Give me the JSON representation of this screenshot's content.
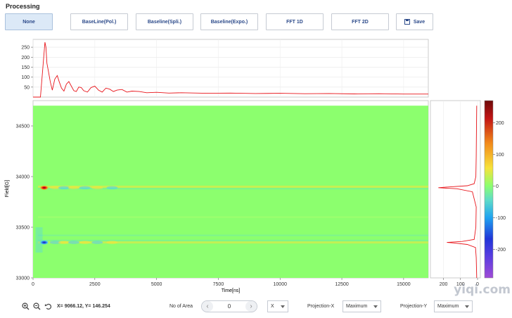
{
  "panel": {
    "title": "Processing"
  },
  "toolbar": {
    "buttons": [
      {
        "label": "None",
        "active": true
      },
      {
        "label": "BaseLine(Pol.)"
      },
      {
        "label": "Baseline(Spli.)"
      },
      {
        "label": "Baseline(Expo.)"
      },
      {
        "label": "FFT 1D"
      },
      {
        "label": "FFT 2D"
      },
      {
        "label": "Save",
        "icon": "save-icon"
      }
    ]
  },
  "chart_data": [
    {
      "type": "line",
      "name": "projection-x",
      "x": [
        0,
        300,
        400,
        480,
        520,
        560,
        620,
        700,
        780,
        880,
        980,
        1050,
        1150,
        1250,
        1350,
        1450,
        1550,
        1650,
        1750,
        1850,
        1950,
        2050,
        2200,
        2350,
        2500,
        2650,
        2800,
        2950,
        3100,
        3250,
        3400,
        3600,
        3800,
        4000,
        4300,
        4600,
        5000,
        5500,
        6000,
        7000,
        8000,
        9000,
        10000,
        11000,
        12000,
        13000,
        14000,
        15000,
        16000
      ],
      "y": [
        0,
        0,
        150,
        275,
        250,
        170,
        130,
        75,
        35,
        90,
        108,
        80,
        45,
        30,
        65,
        78,
        55,
        32,
        28,
        50,
        48,
        32,
        25,
        48,
        55,
        35,
        25,
        45,
        40,
        28,
        35,
        38,
        25,
        30,
        28,
        22,
        24,
        20,
        22,
        19,
        20,
        18,
        19,
        17,
        18,
        16,
        17,
        15,
        15
      ],
      "xlim": [
        0,
        16000
      ],
      "ylim": [
        0,
        275
      ],
      "yticks": [
        "250",
        "200",
        "150",
        "100",
        "50"
      ],
      "color": "#e8141a"
    },
    {
      "type": "heatmap",
      "name": "field-vs-time",
      "xlabel": "Time[ns]",
      "ylabel": "Field[G]",
      "xlim": [
        0,
        16000
      ],
      "ylim": [
        33000,
        34750
      ],
      "xticks": [
        "0",
        "2500",
        "5000",
        "7500",
        "10000",
        "12500",
        "15000"
      ],
      "yticks": [
        "34500",
        "34000",
        "33500",
        "33000"
      ],
      "data_extent": {
        "y": [
          33000,
          34700
        ]
      },
      "background_value": 0,
      "features": [
        {
          "field": 33890,
          "time": 450,
          "value": 260
        },
        {
          "field": 33350,
          "time": 450,
          "value": -190
        }
      ]
    },
    {
      "type": "line",
      "name": "projection-y",
      "xticks": [
        "200",
        "100",
        "0"
      ],
      "field": [
        33000,
        33200,
        33300,
        33330,
        33345,
        33350,
        33360,
        33380,
        33500,
        33700,
        33850,
        33880,
        33890,
        33900,
        33910,
        33930,
        34000,
        34200,
        34500,
        34700
      ],
      "value": [
        5,
        8,
        12,
        60,
        140,
        180,
        90,
        20,
        10,
        8,
        30,
        120,
        230,
        150,
        60,
        20,
        10,
        8,
        6,
        5
      ],
      "color": "#e8141a"
    },
    {
      "type": "colorbar",
      "ticks": [
        "200",
        "100",
        "0",
        "-100",
        "-200"
      ],
      "range": [
        -290,
        270
      ],
      "colors": [
        "#a04bd6",
        "#2035d8",
        "#1fa3f0",
        "#5fdcc8",
        "#8cff6e",
        "#f7e23a",
        "#f28a1a",
        "#c21414",
        "#6e0a0a"
      ]
    }
  ],
  "status": {
    "coords_text": "X= 9066.12,  Y= 146.254",
    "zoom_in_icon": "zoom-in-icon",
    "zoom_out_icon": "zoom-out-icon",
    "reset_icon": "reset-icon"
  },
  "area": {
    "label": "No of Area",
    "value": "0"
  },
  "axis_select": {
    "value": "X"
  },
  "projection_x": {
    "label": "Projection-X",
    "value": "Maximum"
  },
  "projection_y": {
    "label": "Projection-Y",
    "value": "Maximum"
  },
  "watermark": "yiqi.com"
}
